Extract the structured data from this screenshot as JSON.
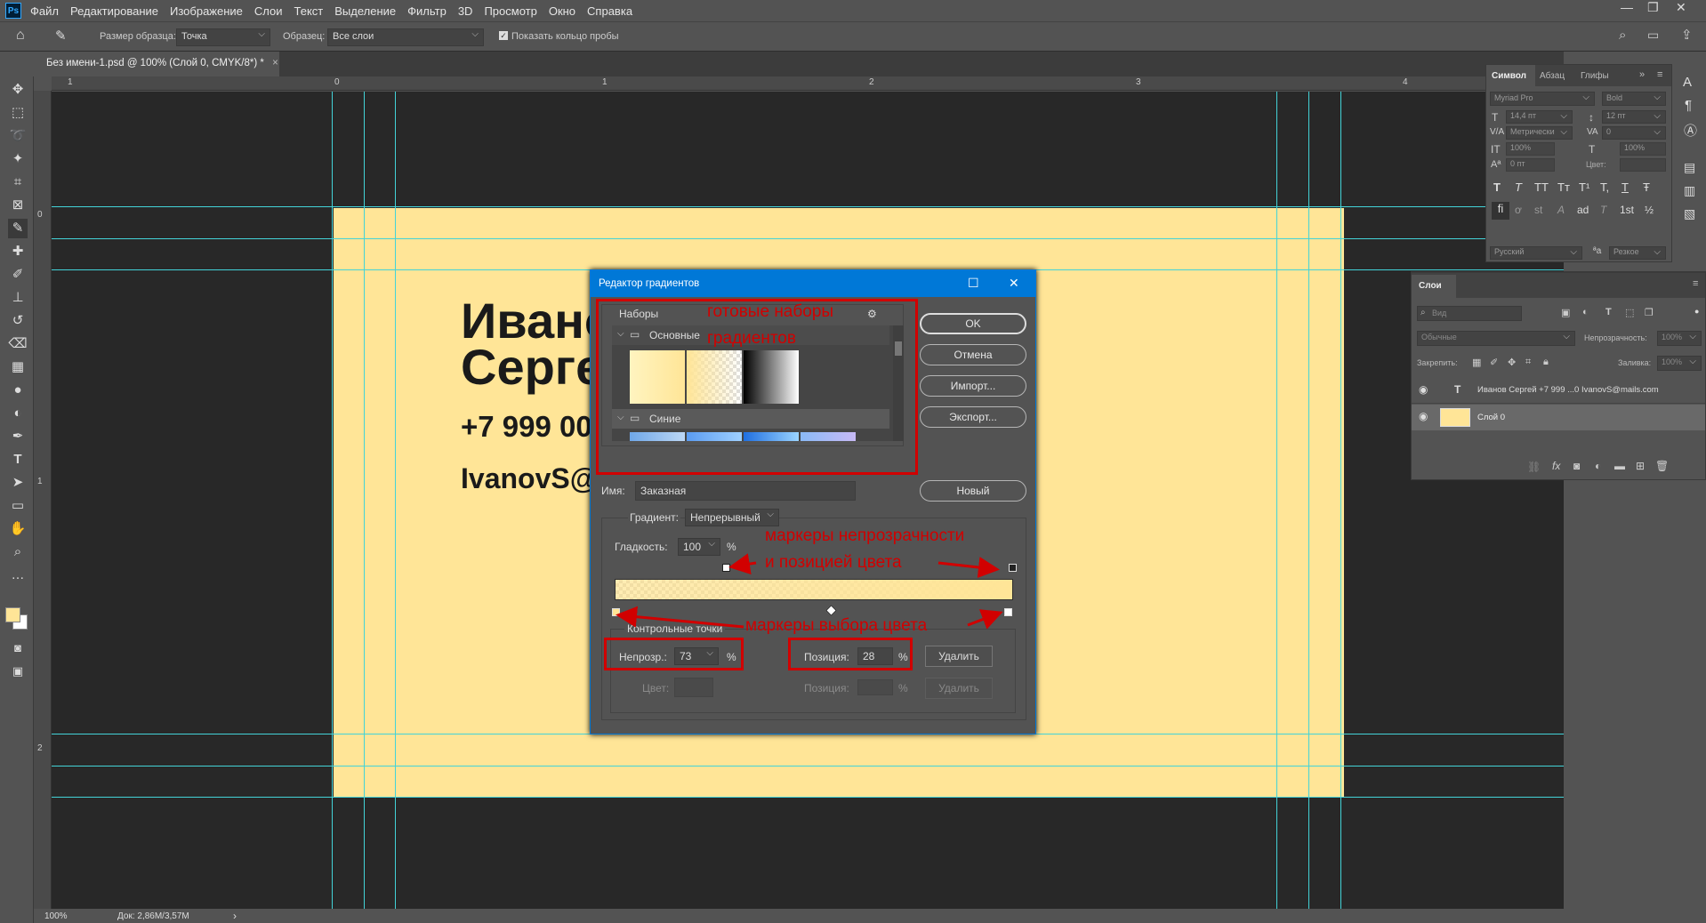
{
  "menubar": {
    "logo": "Ps",
    "items": [
      "Файл",
      "Редактирование",
      "Изображение",
      "Слои",
      "Текст",
      "Выделение",
      "Фильтр",
      "3D",
      "Просмотр",
      "Окно",
      "Справка"
    ]
  },
  "options": {
    "sample_size_label": "Размер образца:",
    "sample_size_value": "Точка",
    "sample_label": "Образец:",
    "sample_value": "Все слои",
    "show_ring_label": "Показать кольцо пробы"
  },
  "document_tab": {
    "title": "Без имени-1.psd @ 100% (Слой 0, CMYK/8*) *",
    "close": "×"
  },
  "rulers": {
    "top": [
      "1",
      "0",
      "1",
      "2",
      "3",
      "4"
    ],
    "left": [
      "0",
      "1",
      "2"
    ]
  },
  "card": {
    "name_line1": "Иванов",
    "name_line2": "Сергей",
    "phone": "+7 999 00",
    "email": "IvanovS@"
  },
  "status": {
    "zoom": "100%",
    "doc": "Док: 2,86M/3,57M",
    "arrow": "›"
  },
  "dialog": {
    "title": "Редактор градиентов",
    "presets_label": "Наборы",
    "group_basic": "Основные",
    "group_blue": "Синие",
    "ok": "OK",
    "cancel": "Отмена",
    "import": "Импорт...",
    "export": "Экспорт...",
    "name_label": "Имя:",
    "name_value": "Заказная",
    "new": "Новый",
    "gradient_type_label": "Градиент:",
    "gradient_type_value": "Непрерывный",
    "smoothness_label": "Гладкость:",
    "smoothness_value": "100",
    "percent": "%",
    "stops_label": "Контрольные точки",
    "opacity_label": "Непрозр.:",
    "opacity_value": "73",
    "position_label": "Позиция:",
    "position_value": "28",
    "delete": "Удалить",
    "color_label": "Цвет:",
    "position2_label": "Позиция:",
    "delete2": "Удалить",
    "window_max": "☐",
    "window_close": "✕"
  },
  "annotations": {
    "presets_line1": "готовые наборы",
    "presets_line2": "градиентов",
    "opacity_line1": "маркеры непрозрачности",
    "opacity_line2": "и позицией цвета",
    "color_markers": "маркеры выбора цвета"
  },
  "character_panel": {
    "tabs": [
      "Символ",
      "Абзац",
      "Глифы"
    ],
    "font_family": "Myriad Pro",
    "font_style": "Bold",
    "size": "14,4 пт",
    "leading": "12 пт",
    "kerning": "Метрически",
    "tracking": "0",
    "vscale": "100%",
    "hscale": "100%",
    "baseline": "0 пт",
    "color_label": "Цвет:",
    "language": "Русский",
    "aa_label": "ªa",
    "aa_value": "Резкое",
    "style_buttons": [
      "T",
      "T",
      "TT",
      "Tт",
      "T¹",
      "T,",
      "T",
      "Ŧ"
    ],
    "ot_buttons": [
      "fi",
      "ơ",
      "st",
      "A",
      "ad",
      "T",
      "1st",
      "½"
    ]
  },
  "layers_panel": {
    "title": "Слои",
    "search_placeholder": "Вид",
    "blend_mode": "Обычные",
    "opacity_label": "Непрозрачность:",
    "opacity_value": "100%",
    "lock_label": "Закрепить:",
    "fill_label": "Заливка:",
    "fill_value": "100%",
    "layers": [
      {
        "name": "Иванов Сергей +7 999 ...0  IvanovS@mails.com",
        "type": "text"
      },
      {
        "name": "Слой 0",
        "type": "pixel"
      }
    ],
    "footer_fx": "fx"
  },
  "colors": {
    "foreground": "#ffe597",
    "background": "#ffffff",
    "accent": "#0078d7",
    "annotation": "#d10000"
  }
}
